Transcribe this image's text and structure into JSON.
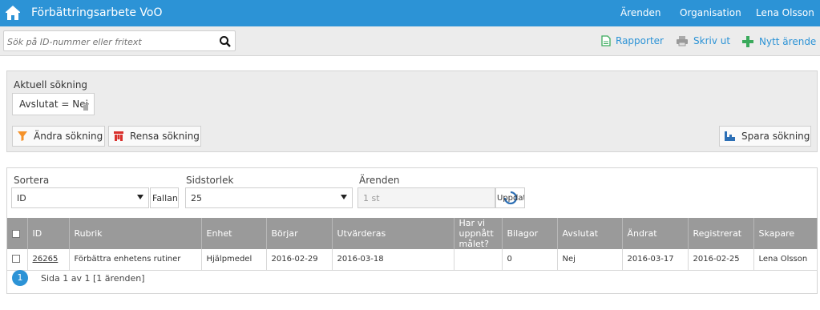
{
  "header": {
    "title": "Förbättringsarbete VoO",
    "nav": [
      "Ärenden",
      "Organisation",
      "Lena Olsson"
    ]
  },
  "toolbar": {
    "search_placeholder": "Sök på ID-nummer eller fritext",
    "reports_label": "Rapporter",
    "print_label": "Skriv ut",
    "new_label": "Nytt ärende"
  },
  "search_panel": {
    "current_label": "Aktuell sökning",
    "filter_chip": "Avslutat = Nej",
    "change_label": "Ändra sökning",
    "clear_label": "Rensa sökning",
    "save_label": "Spara sökning"
  },
  "controls": {
    "sort_label": "Sortera",
    "sort_value": "ID",
    "order_value": "Fallande",
    "page_size_label": "Sidstorlek",
    "page_size_value": "25",
    "cases_label": "Ärenden",
    "cases_value": "1 st",
    "update_label": "Uppdatera"
  },
  "table": {
    "columns": [
      "ID",
      "Rubrik",
      "Enhet",
      "Börjar",
      "Utvärderas",
      "Har vi uppnått målet?",
      "Bilagor",
      "Avslutat",
      "Ändrat",
      "Registrerat",
      "Skapare"
    ],
    "rows": [
      [
        "26265",
        "Förbättra enhetens rutiner",
        "Hjälpmedel",
        "2016-02-29",
        "2016-03-18",
        "",
        "0",
        "Nej",
        "2016-03-17",
        "2016-02-25",
        "Lena Olsson"
      ]
    ]
  },
  "pagination": {
    "page": "1",
    "summary": "Sida 1 av 1 [1 ärenden]"
  },
  "colors": {
    "accent": "#2c93d6",
    "header_gray": "#9a9a9a"
  }
}
